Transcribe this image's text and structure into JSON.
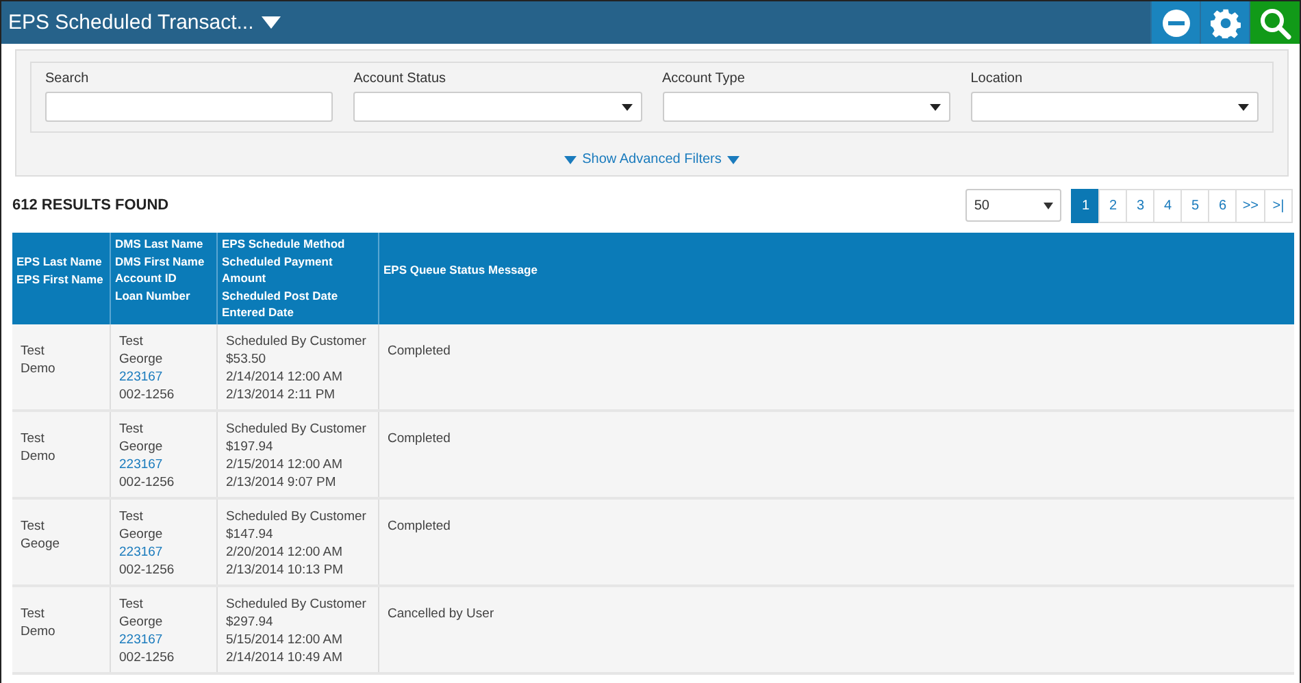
{
  "header": {
    "title": "EPS Scheduled Transact...",
    "buttons": [
      {
        "kind": "minus"
      },
      {
        "kind": "gear"
      },
      {
        "kind": "search"
      }
    ]
  },
  "filters": {
    "fields": [
      {
        "label": "Search",
        "kind": "text"
      },
      {
        "label": "Account Status",
        "kind": "select"
      },
      {
        "label": "Account Type",
        "kind": "select"
      },
      {
        "label": "Location",
        "kind": "select"
      }
    ],
    "advanced_link": "Show Advanced Filters"
  },
  "results": {
    "count": "612 RESULTS FOUND",
    "page_size": "50",
    "pages": [
      {
        "label": "1",
        "selected": true
      },
      {
        "label": "2",
        "selected": false
      },
      {
        "label": "3",
        "selected": false
      },
      {
        "label": "4",
        "selected": false
      },
      {
        "label": "5",
        "selected": false
      },
      {
        "label": "6",
        "selected": false
      },
      {
        "label": ">>",
        "selected": false
      },
      {
        "label": ">|",
        "selected": false
      }
    ]
  },
  "table": {
    "columns": [
      {
        "lines": [
          "EPS Last Name",
          "EPS First Name"
        ]
      },
      {
        "lines": [
          "DMS Last Name",
          "DMS First Name",
          "Account ID",
          "Loan Number"
        ]
      },
      {
        "lines": [
          "EPS Schedule Method",
          "Scheduled Payment Amount",
          "Scheduled Post Date",
          "Entered Date"
        ]
      },
      {
        "lines": [
          "EPS Queue Status Message"
        ]
      }
    ],
    "rows": [
      {
        "eps_last_name": "Test",
        "eps_first_name": "Demo",
        "dms_last_name": "Test",
        "dms_first_name": "George",
        "account_id": "223167",
        "loan_number": "002-1256",
        "method": "Scheduled By Customer",
        "amount": "$53.50",
        "post_date": "2/14/2014 12:00 AM",
        "entered_date": "2/13/2014 2:11 PM",
        "status": "Completed"
      },
      {
        "eps_last_name": "Test",
        "eps_first_name": "Demo",
        "dms_last_name": "Test",
        "dms_first_name": "George",
        "account_id": "223167",
        "loan_number": "002-1256",
        "method": "Scheduled By Customer",
        "amount": "$197.94",
        "post_date": "2/15/2014 12:00 AM",
        "entered_date": "2/13/2014 9:07 PM",
        "status": "Completed"
      },
      {
        "eps_last_name": "Test",
        "eps_first_name": "Geoge",
        "dms_last_name": "Test",
        "dms_first_name": "George",
        "account_id": "223167",
        "loan_number": "002-1256",
        "method": "Scheduled By Customer",
        "amount": "$147.94",
        "post_date": "2/20/2014 12:00 AM",
        "entered_date": "2/13/2014 10:13 PM",
        "status": "Completed"
      },
      {
        "eps_last_name": "Test",
        "eps_first_name": "Demo",
        "dms_last_name": "Test",
        "dms_first_name": "George",
        "account_id": "223167",
        "loan_number": "002-1256",
        "method": "Scheduled By Customer",
        "amount": "$297.94",
        "post_date": "5/15/2014 12:00 AM",
        "entered_date": "2/14/2014 10:49 AM",
        "status": "Cancelled by User"
      }
    ]
  }
}
